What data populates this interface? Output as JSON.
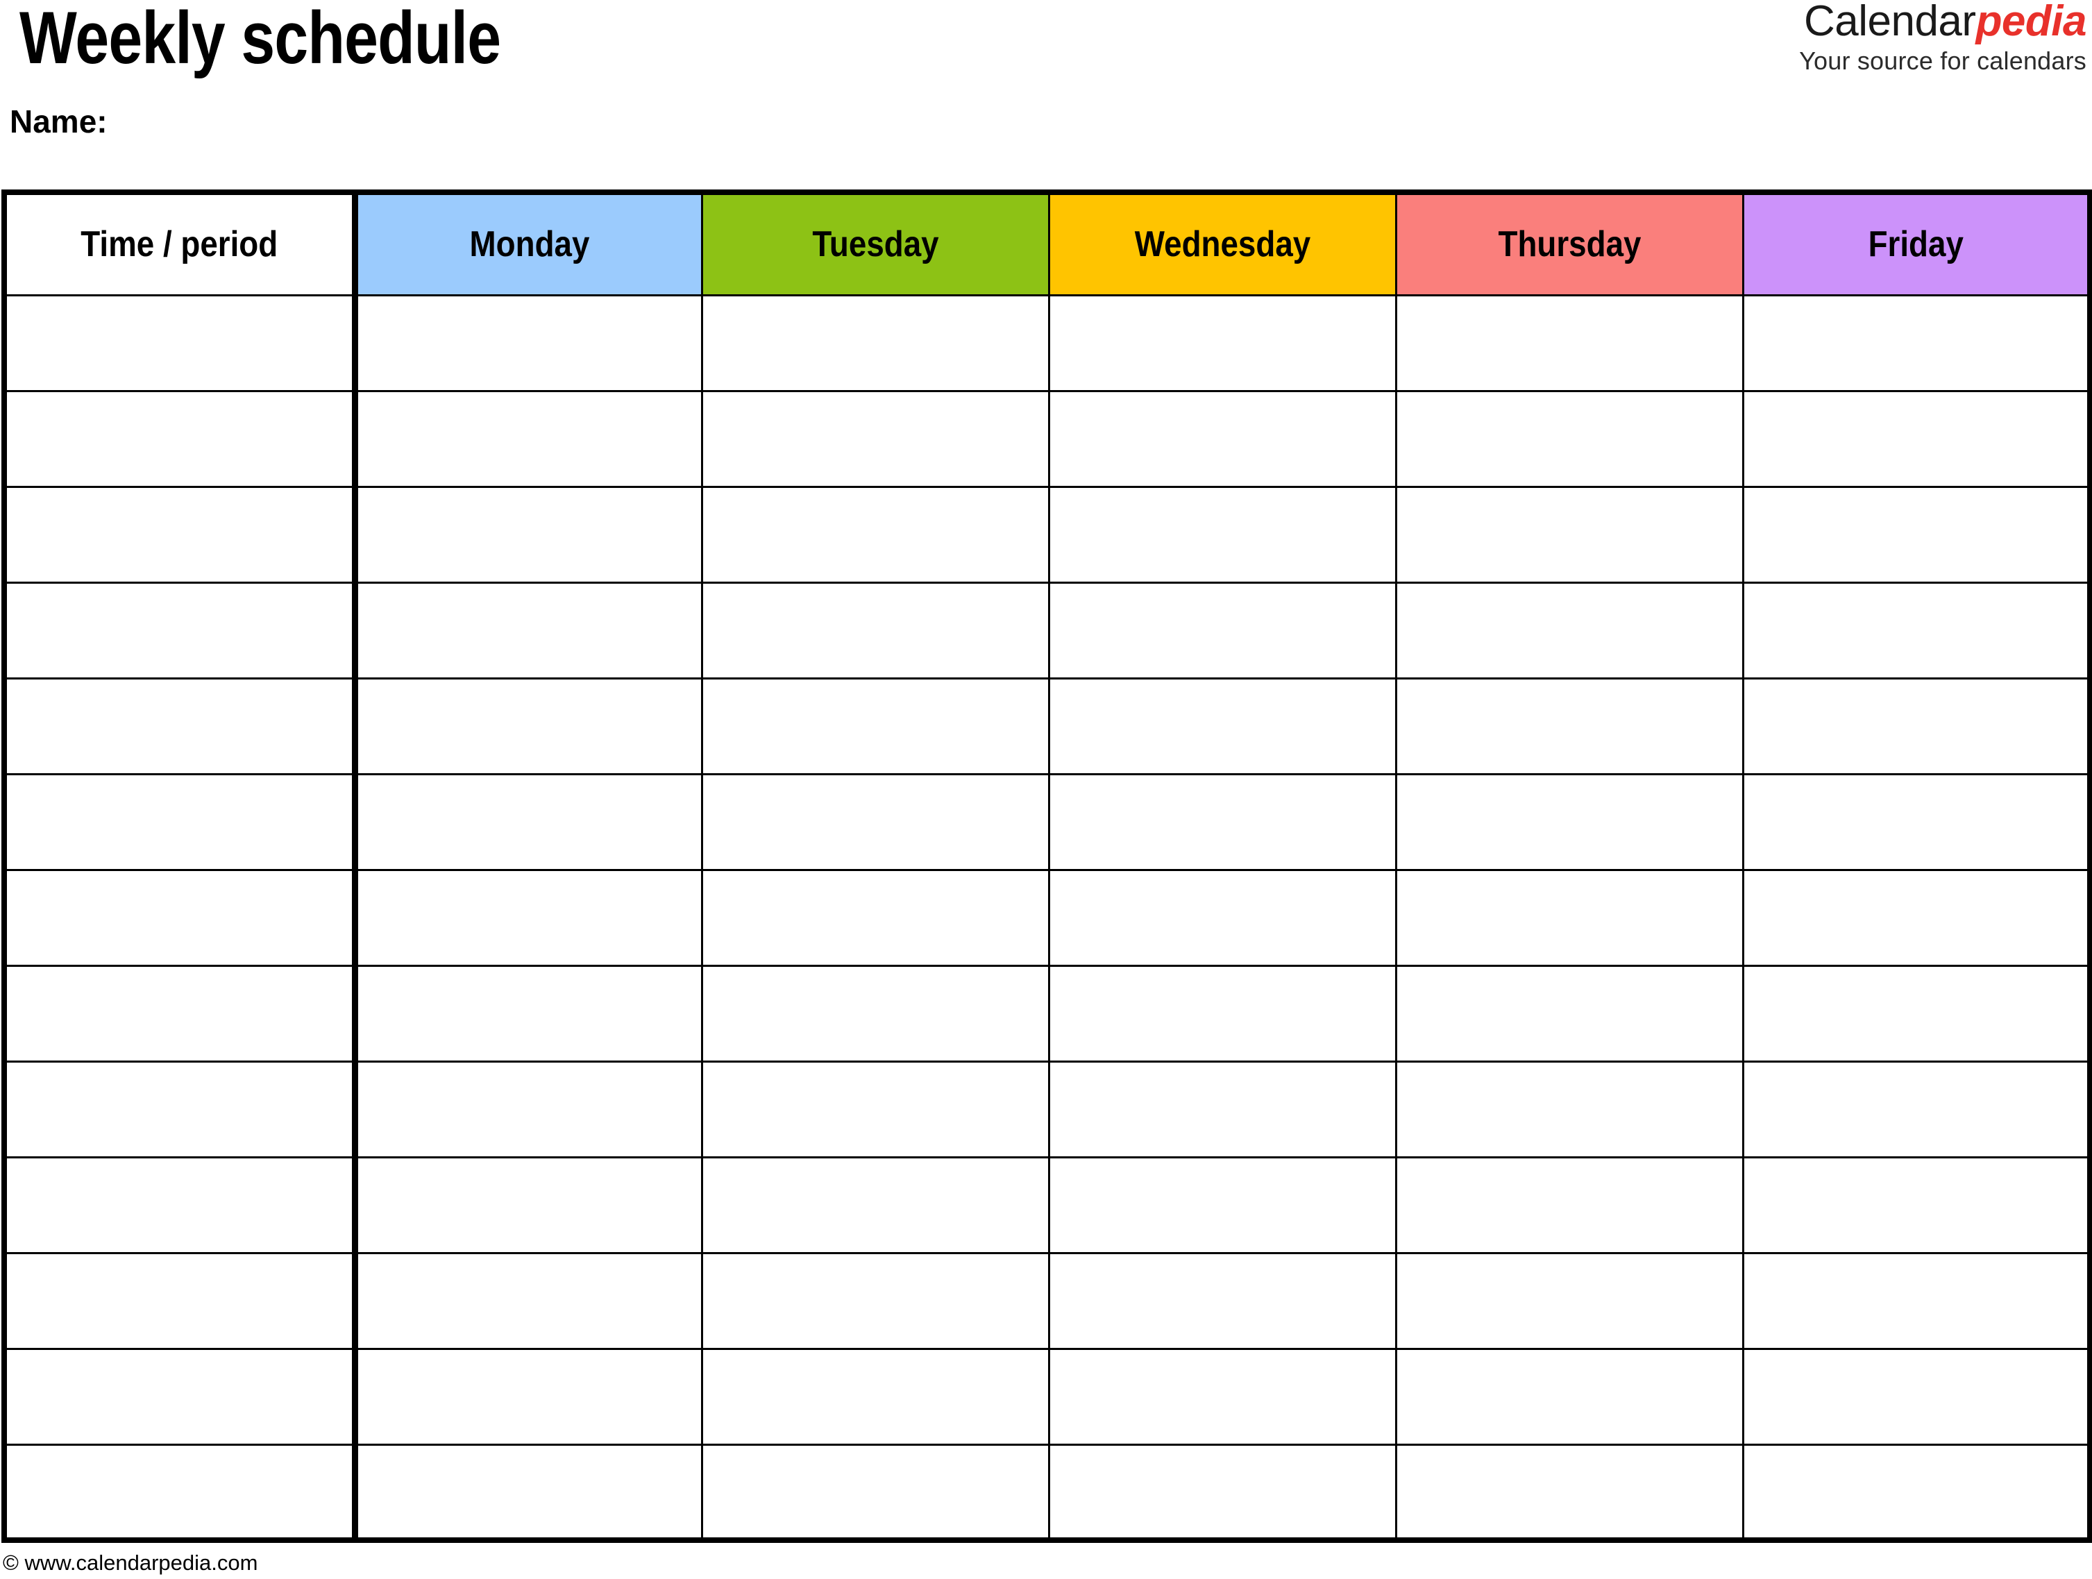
{
  "document": {
    "title": "Weekly schedule",
    "name_label": "Name:"
  },
  "brand": {
    "word_primary": "Calendar",
    "word_accent": "pedia",
    "tagline": "Your source for calendars",
    "accent_color": "#E8312B",
    "primary_color": "#1A1A1A"
  },
  "table": {
    "columns": [
      {
        "key": "time",
        "label": "Time / period",
        "header_bg": "#FFFFFF"
      },
      {
        "key": "monday",
        "label": "Monday",
        "header_bg": "#9BCBFD"
      },
      {
        "key": "tuesday",
        "label": "Tuesday",
        "header_bg": "#8DC215"
      },
      {
        "key": "wednesday",
        "label": "Wednesday",
        "header_bg": "#FFC400"
      },
      {
        "key": "thursday",
        "label": "Thursday",
        "header_bg": "#FA7F7C"
      },
      {
        "key": "friday",
        "label": "Friday",
        "header_bg": "#CC92FA"
      }
    ],
    "row_count": 13,
    "rows": [
      {
        "time": "",
        "monday": "",
        "tuesday": "",
        "wednesday": "",
        "thursday": "",
        "friday": ""
      },
      {
        "time": "",
        "monday": "",
        "tuesday": "",
        "wednesday": "",
        "thursday": "",
        "friday": ""
      },
      {
        "time": "",
        "monday": "",
        "tuesday": "",
        "wednesday": "",
        "thursday": "",
        "friday": ""
      },
      {
        "time": "",
        "monday": "",
        "tuesday": "",
        "wednesday": "",
        "thursday": "",
        "friday": ""
      },
      {
        "time": "",
        "monday": "",
        "tuesday": "",
        "wednesday": "",
        "thursday": "",
        "friday": ""
      },
      {
        "time": "",
        "monday": "",
        "tuesday": "",
        "wednesday": "",
        "thursday": "",
        "friday": ""
      },
      {
        "time": "",
        "monday": "",
        "tuesday": "",
        "wednesday": "",
        "thursday": "",
        "friday": ""
      },
      {
        "time": "",
        "monday": "",
        "tuesday": "",
        "wednesday": "",
        "thursday": "",
        "friday": ""
      },
      {
        "time": "",
        "monday": "",
        "tuesday": "",
        "wednesday": "",
        "thursday": "",
        "friday": ""
      },
      {
        "time": "",
        "monday": "",
        "tuesday": "",
        "wednesday": "",
        "thursday": "",
        "friday": ""
      },
      {
        "time": "",
        "monday": "",
        "tuesday": "",
        "wednesday": "",
        "thursday": "",
        "friday": ""
      },
      {
        "time": "",
        "monday": "",
        "tuesday": "",
        "wednesday": "",
        "thursday": "",
        "friday": ""
      },
      {
        "time": "",
        "monday": "",
        "tuesday": "",
        "wednesday": "",
        "thursday": "",
        "friday": ""
      }
    ]
  },
  "footer": {
    "copyright": "© www.calendarpedia.com"
  }
}
